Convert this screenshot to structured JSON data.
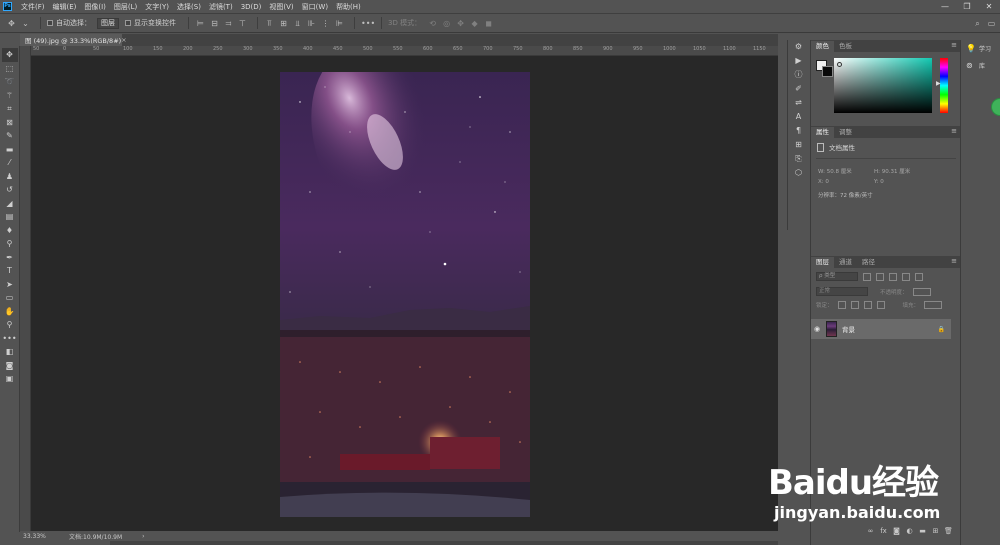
{
  "app": {
    "logo_text": "Ps"
  },
  "menu": [
    "文件(F)",
    "编辑(E)",
    "图像(I)",
    "图层(L)",
    "文字(Y)",
    "选择(S)",
    "滤镜(T)",
    "3D(D)",
    "视图(V)",
    "窗口(W)",
    "帮助(H)"
  ],
  "window_controls": {
    "minimize": "—",
    "restore": "❐",
    "close": "✕"
  },
  "options_bar": {
    "auto_select_label": "自动选择：",
    "auto_select_value": "图层",
    "show_transform_label": "显示变换控件",
    "mode_3d_label": "3D 模式："
  },
  "document": {
    "tab_title": "图 (49).jpg @ 33.3%(RGB/8#)",
    "tab_close": "×"
  },
  "ruler_labels": [
    "50",
    "0",
    "50",
    "100",
    "150",
    "200",
    "250",
    "300",
    "350",
    "400",
    "450",
    "500",
    "550",
    "600",
    "650",
    "700",
    "750",
    "800",
    "850",
    "900",
    "950",
    "1000",
    "1050",
    "1100",
    "1150"
  ],
  "status": {
    "zoom": "33.33%",
    "doc_size": "文档:10.9M/10.9M",
    "arrow": "›"
  },
  "color_panel": {
    "tabs": [
      "颜色",
      "色板"
    ]
  },
  "properties_panel": {
    "tabs": [
      "属性",
      "调整"
    ],
    "heading": "文档属性",
    "w_label": "W:",
    "w_value": "50.8 厘米",
    "h_label": "H:",
    "h_value": "90.31 厘米",
    "x_label": "X:",
    "x_value": "0",
    "y_label": "Y:",
    "y_value": "0",
    "resolution": "分辨率：72 像素/英寸"
  },
  "layers_panel": {
    "tabs": [
      "图层",
      "通道",
      "路径"
    ],
    "kind_placeholder": "ρ 类型",
    "blend_mode": "正常",
    "opacity_label": "不透明度：",
    "lock_label": "锁定：",
    "fill_label": "填充：",
    "layer_name": "背景"
  },
  "right_strip": {
    "learn_label": "学习",
    "library_label": "库"
  },
  "watermark": {
    "brand": "Baidu经验",
    "url": "jingyan.baidu.com"
  },
  "colors": {
    "ui_base": "#535353",
    "canvas_bg": "#282828",
    "picker_hue": "#13c9b2",
    "accent_badge": "#3fb25a"
  }
}
